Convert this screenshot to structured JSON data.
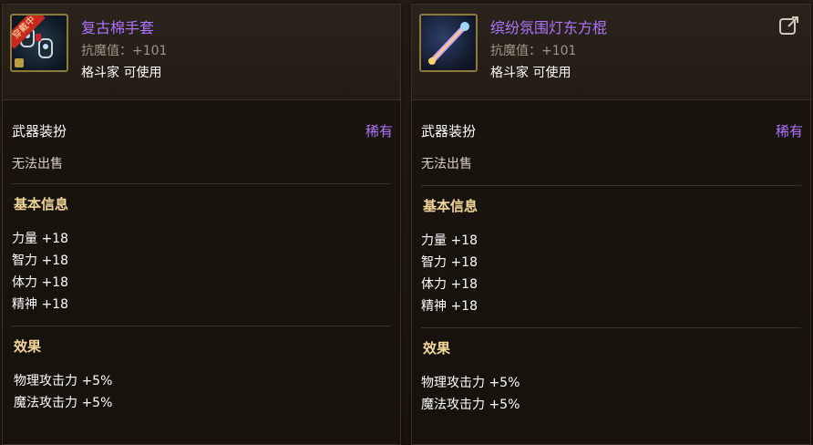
{
  "left": {
    "title": "复古棉手套",
    "resist": "抗魔值：+101",
    "user": "格斗家 可使用",
    "badge": "穿戴中",
    "type_label": "武器装扮",
    "rarity": "稀有",
    "sell_note": "无法出售",
    "basic_heading": "基本信息",
    "stats": [
      "力量 +18",
      "智力 +18",
      "体力 +18",
      "精神 +18"
    ],
    "effect_heading": "效果",
    "effects": [
      "物理攻击力 +5%",
      "魔法攻击力 +5%"
    ]
  },
  "right": {
    "title": "缤纷氛围灯东方棍",
    "resist": "抗魔值：+101",
    "user": "格斗家 可使用",
    "type_label": "武器装扮",
    "rarity": "稀有",
    "sell_note": "无法出售",
    "basic_heading": "基本信息",
    "stats": [
      "力量 +18",
      "智力 +18",
      "体力 +18",
      "精神 +18"
    ],
    "effect_heading": "效果",
    "effects": [
      "物理攻击力 +5%",
      "魔法攻击力 +5%"
    ]
  },
  "icons": {
    "left_item": "gloves-icon",
    "right_item": "staff-icon",
    "export": "export-icon",
    "lock": "lock-icon"
  },
  "colors": {
    "rarity": "#b073ff",
    "heading": "#f2d79a",
    "badge": "#c8291e"
  }
}
